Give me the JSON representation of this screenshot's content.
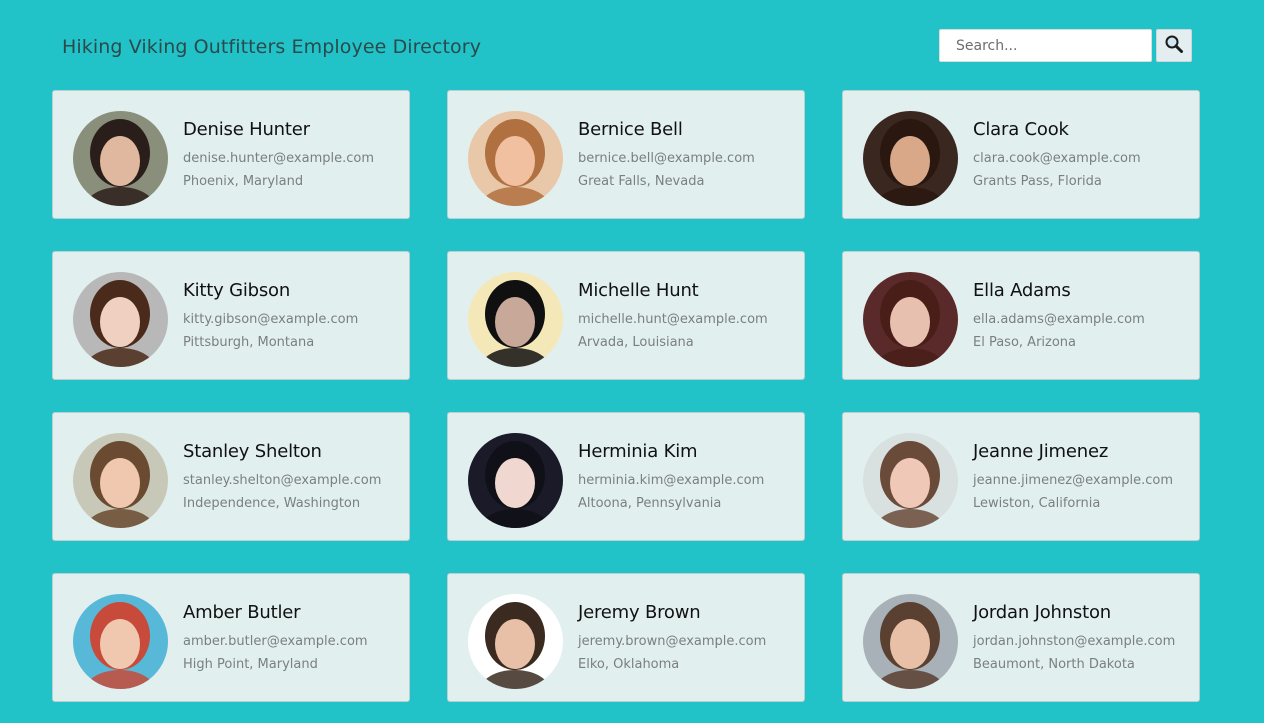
{
  "header": {
    "title": "Hiking Viking Outfitters Employee Directory",
    "search_placeholder": "Search...",
    "search_icon": "magnifier-icon"
  },
  "employees": [
    {
      "name": "Denise Hunter",
      "email": "denise.hunter@example.com",
      "location": "Phoenix, Maryland",
      "avatar_bg": "#8a8f7c",
      "avatar_face": "#e0b8a0",
      "avatar_hair": "#2a1e1a"
    },
    {
      "name": "Bernice Bell",
      "email": "bernice.bell@example.com",
      "location": "Great Falls, Nevada",
      "avatar_bg": "#e8c8a8",
      "avatar_face": "#f0c0a0",
      "avatar_hair": "#b07040"
    },
    {
      "name": "Clara Cook",
      "email": "clara.cook@example.com",
      "location": "Grants Pass, Florida",
      "avatar_bg": "#3a2820",
      "avatar_face": "#d8a888",
      "avatar_hair": "#2a1810"
    },
    {
      "name": "Kitty Gibson",
      "email": "kitty.gibson@example.com",
      "location": "Pittsburgh, Montana",
      "avatar_bg": "#b8b8b8",
      "avatar_face": "#f0d0c0",
      "avatar_hair": "#4a2a1a"
    },
    {
      "name": "Michelle Hunt",
      "email": "michelle.hunt@example.com",
      "location": "Arvada, Louisiana",
      "avatar_bg": "#f5e8b8",
      "avatar_face": "#c8a898",
      "avatar_hair": "#101010"
    },
    {
      "name": "Ella Adams",
      "email": "ella.adams@example.com",
      "location": "El Paso, Arizona",
      "avatar_bg": "#5a2a2a",
      "avatar_face": "#e8c0b0",
      "avatar_hair": "#4a1e18"
    },
    {
      "name": "Stanley Shelton",
      "email": "stanley.shelton@example.com",
      "location": "Independence, Washington",
      "avatar_bg": "#c8c8b8",
      "avatar_face": "#f0c8b0",
      "avatar_hair": "#6a4a30"
    },
    {
      "name": "Herminia Kim",
      "email": "herminia.kim@example.com",
      "location": "Altoona, Pennsylvania",
      "avatar_bg": "#1a1a28",
      "avatar_face": "#f0d8d0",
      "avatar_hair": "#101018"
    },
    {
      "name": "Jeanne Jimenez",
      "email": "jeanne.jimenez@example.com",
      "location": "Lewiston, California",
      "avatar_bg": "#d8e0e0",
      "avatar_face": "#f0c8b8",
      "avatar_hair": "#6a4a38"
    },
    {
      "name": "Amber Butler",
      "email": "amber.butler@example.com",
      "location": "High Point, Maryland",
      "avatar_bg": "#58b8d8",
      "avatar_face": "#f0c8b0",
      "avatar_hair": "#c84a3a"
    },
    {
      "name": "Jeremy Brown",
      "email": "jeremy.brown@example.com",
      "location": "Elko, Oklahoma",
      "avatar_bg": "#ffffff",
      "avatar_face": "#e8c0a8",
      "avatar_hair": "#3a2a20"
    },
    {
      "name": "Jordan Johnston",
      "email": "jordan.johnston@example.com",
      "location": "Beaumont, North Dakota",
      "avatar_bg": "#a8b0b8",
      "avatar_face": "#e8c0a8",
      "avatar_hair": "#5a4030"
    }
  ]
}
